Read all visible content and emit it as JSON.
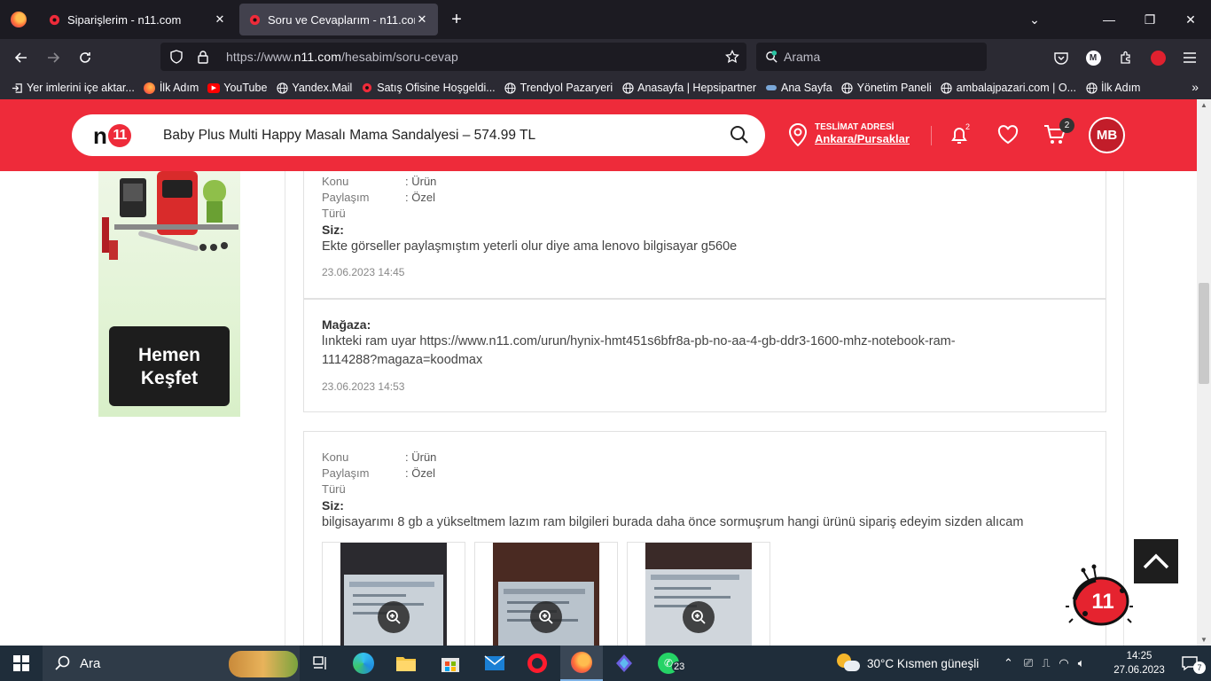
{
  "browser": {
    "tabs": [
      {
        "title": "Siparişlerim - n11.com",
        "active": false
      },
      {
        "title": "Soru ve Cevaplarım - n11.com",
        "active": true
      }
    ],
    "url_prefix": "https://www.",
    "url_domain": "n11.com",
    "url_path": "/hesabim/soru-cevap",
    "search_placeholder": "Arama",
    "bookmarks": [
      "Yer imlerini içe aktar...",
      "İlk Adım",
      "YouTube",
      "Yandex.Mail",
      "Satış Ofisine Hoşgeldi...",
      "Trendyol Pazaryeri",
      "Anasayfa | Hepsipartner",
      "Ana Sayfa",
      "Yönetim Paneli",
      "ambalajpazari.com | O...",
      "İlk Adım"
    ]
  },
  "header": {
    "logo": "n11",
    "search_value": "Baby Plus Multi Happy Masalı Mama Sandalyesi – 574.99 TL",
    "address_label": "TESLİMAT ADRESİ",
    "address_value": "Ankara/Pursaklar",
    "notification_count": "2",
    "cart_count": "2",
    "avatar_initials": "MB"
  },
  "banner": {
    "cta": "Hemen Keşfet"
  },
  "qa": {
    "card1": {
      "meta": [
        {
          "key": "Konu",
          "value": ": Ürün"
        },
        {
          "key": "Paylaşım",
          "value": ": Özel"
        },
        {
          "key": "Türü",
          "value": ""
        }
      ],
      "who": "Siz:",
      "message": "Ekte görseller paylaşmıştım yeterli olur diye ama lenovo bilgisayar g560e",
      "timestamp": "23.06.2023 14:45"
    },
    "card2": {
      "who": "Mağaza:",
      "message": "lınkteki ram uyar https://www.n11.com/urun/hynix-hmt451s6bfr8a-pb-no-aa-4-gb-ddr3-1600-mhz-notebook-ram-1114288?magaza=koodmax",
      "timestamp": "23.06.2023 14:53"
    },
    "card3": {
      "meta": [
        {
          "key": "Konu",
          "value": ": Ürün"
        },
        {
          "key": "Paylaşım",
          "value": ": Özel"
        },
        {
          "key": "Türü",
          "value": ""
        }
      ],
      "who": "Siz:",
      "message": "bilgisayarımı 8 gb a yükseltmem lazım ram bilgileri burada daha önce sormuşrum hangi ürünü sipariş edeyim sizden alıcam",
      "attachments": 3
    }
  },
  "taskbar": {
    "search_placeholder": "Ara",
    "weather": "30°C  Kısmen güneşli",
    "time": "14:25",
    "date": "27.06.2023",
    "whatsapp_badge": "23",
    "notification_count": "7"
  },
  "colors": {
    "brand_red": "#ee2b3a",
    "browser_dark": "#1c1b22",
    "taskbar": "#1f2d3a"
  }
}
